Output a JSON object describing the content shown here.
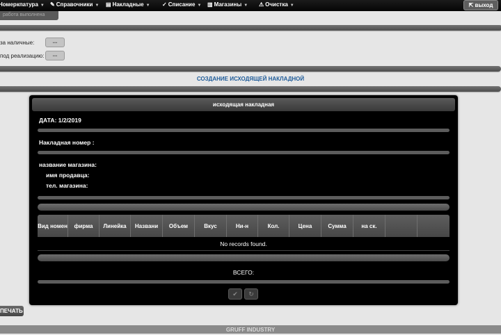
{
  "menu": {
    "items": [
      {
        "icon": "",
        "label": "Номеркпатура"
      },
      {
        "icon": "✎",
        "label": "Справочники"
      },
      {
        "icon": "▤",
        "label": "Накладные"
      },
      {
        "icon": "✓",
        "label": "Списание"
      },
      {
        "icon": "▥",
        "label": "Магазины"
      },
      {
        "icon": "⚠",
        "label": "Очистка"
      }
    ],
    "exit_label": "выход",
    "exit_icon": "⇱"
  },
  "ghost_label": "работа выполнена",
  "fields": {
    "cash_label": "за наличные:",
    "consign_label": "под реализацию:",
    "cash_btn": "...",
    "consign_btn": "..."
  },
  "section_title": "СОЗДАНИЕ ИСХОДЯЩЕЙ НАКЛАДНОЙ",
  "panel": {
    "header": "исходящая накладная",
    "date": "ДАТА: 1/2/2019",
    "invoice_number": "Накладная номер :",
    "store_name": "название магазина:",
    "seller_name": "имя продавца:",
    "store_phone": "тел. магазина:",
    "columns": [
      "Вид номен",
      "фирма",
      "Линейка",
      "Названи",
      "Объем",
      "Вкус",
      "Ни-н",
      "Кол.",
      "Цена",
      "Сумма",
      "на ск.",
      ""
    ],
    "empty_message": "No records found.",
    "total_label": "ВСЕГО:",
    "confirm_icon": "✔",
    "refresh_icon": "↻"
  },
  "print_label": "ПЕЧАТЬ",
  "footer": "GRUFF INDUSTRY"
}
